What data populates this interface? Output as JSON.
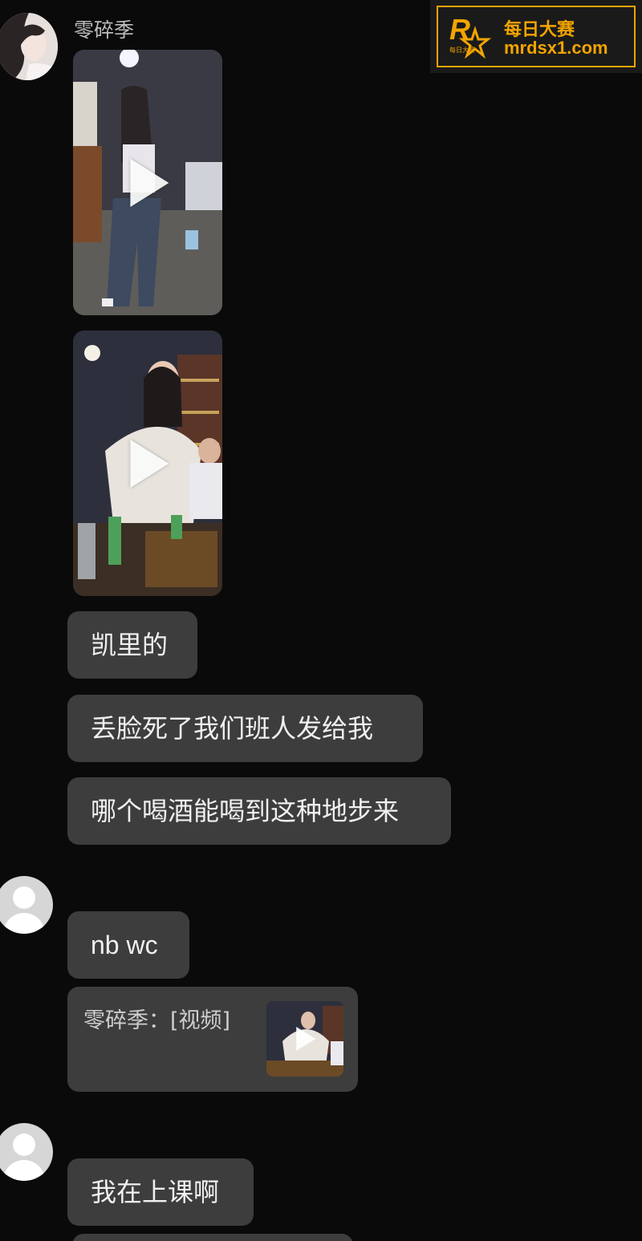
{
  "colors": {
    "background": "#0a0a0a",
    "bubble": "#3d3d3d",
    "bubble_text": "#f0f0f0",
    "sender_name": "#bdbdbd",
    "watermark_accent": "#f2a400"
  },
  "messages": {
    "sender_name": "零碎季",
    "video_1": {
      "type": "video",
      "icon": "play-icon"
    },
    "video_2": {
      "type": "video",
      "icon": "play-icon"
    },
    "text_1": "凯里的",
    "text_2": "丢脸死了我们班人发给我",
    "text_3": "哪个喝酒能喝到这种地步来",
    "reply_1": "nb wc",
    "quote_text": "零碎季：[视频]",
    "reply_2": "我在上课啊"
  },
  "watermark": {
    "title": "每日大赛",
    "url": "mrdsx1.com",
    "logo_letter": "R",
    "logo_caption": "每日大赛"
  }
}
